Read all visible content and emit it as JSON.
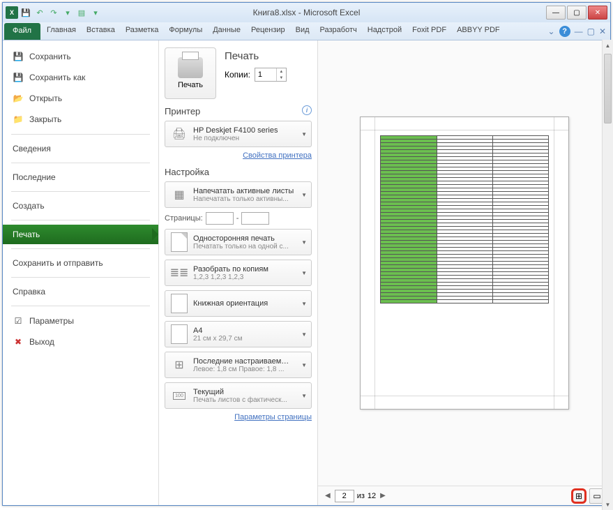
{
  "window": {
    "title": "Книга8.xlsx - Microsoft Excel",
    "qat": [
      "save",
      "undo",
      "redo",
      "repeat",
      "more"
    ]
  },
  "ribbon": {
    "tabs": [
      "Файл",
      "Главная",
      "Вставка",
      "Разметка",
      "Формулы",
      "Данные",
      "Рецензир",
      "Вид",
      "Разработч",
      "Надстрой",
      "Foxit PDF",
      "ABBYY PDF"
    ]
  },
  "sidebar": {
    "items": [
      {
        "icon": "save",
        "label": "Сохранить"
      },
      {
        "icon": "saveas",
        "label": "Сохранить как"
      },
      {
        "icon": "open",
        "label": "Открыть"
      },
      {
        "icon": "close",
        "label": "Закрыть"
      }
    ],
    "groups": [
      "Сведения",
      "Последние",
      "Создать",
      "Печать",
      "Сохранить и отправить",
      "Справка"
    ],
    "bottom": [
      {
        "icon": "options",
        "label": "Параметры"
      },
      {
        "icon": "exit",
        "label": "Выход"
      }
    ],
    "selected": "Печать"
  },
  "print": {
    "header": "Печать",
    "print_btn": "Печать",
    "copies_label": "Копии:",
    "copies_value": "1",
    "printer_header": "Принтер",
    "printer": {
      "name": "HP Deskjet F4100 series",
      "status": "Не подключен"
    },
    "printer_props": "Свойства принтера",
    "settings_header": "Настройка",
    "pages_label": "Страницы:",
    "pages_from": "",
    "pages_to": "",
    "pages_sep": "-",
    "settings": [
      {
        "icon": "sheets",
        "title": "Напечатать активные листы",
        "sub": "Напечатать только активны..."
      },
      {
        "icon": "oneside",
        "title": "Односторонняя печать",
        "sub": "Печатать только на одной с..."
      },
      {
        "icon": "collate",
        "title": "Разобрать по копиям",
        "sub": "1,2,3   1,2,3   1,2,3"
      },
      {
        "icon": "portrait",
        "title": "Книжная ориентация",
        "sub": ""
      },
      {
        "icon": "a4",
        "title": "A4",
        "sub": "21 см x 29,7 см"
      },
      {
        "icon": "margins",
        "title": "Последние настраиваемые ...",
        "sub": "Левое: 1,8 см   Правое: 1,8 ..."
      },
      {
        "icon": "scale",
        "title": "Текущий",
        "sub": "Печать листов с фактическ..."
      }
    ],
    "page_setup": "Параметры страницы"
  },
  "preview": {
    "page_current": "2",
    "page_total": "12",
    "page_of": "из",
    "rows": 48
  }
}
